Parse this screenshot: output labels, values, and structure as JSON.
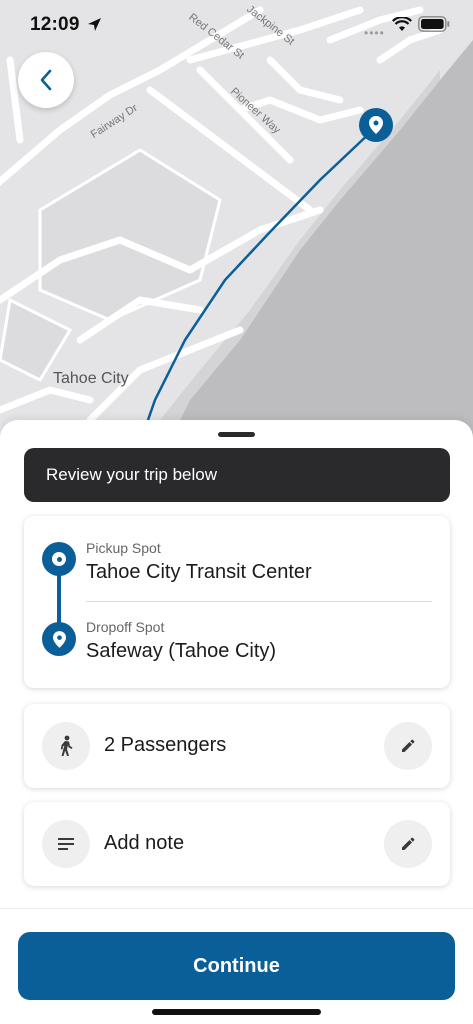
{
  "status_bar": {
    "time": "12:09",
    "icons": [
      "location-arrow-icon",
      "wifi-icon",
      "battery-icon"
    ]
  },
  "map": {
    "town_label": "Tahoe City",
    "streets": [
      "Fairway Dr",
      "Red Cedar St",
      "Jackpine St",
      "Pioneer Way"
    ],
    "route_color": "#0b5f99",
    "pin_icon": "map-pin-icon"
  },
  "nav": {
    "back_icon": "chevron-left-icon"
  },
  "banner": {
    "text": "Review your trip below"
  },
  "trip": {
    "pickup_label": "Pickup Spot",
    "pickup_name": "Tahoe City Transit Center",
    "dropoff_label": "Dropoff Spot",
    "dropoff_name": "Safeway (Tahoe City)"
  },
  "passengers": {
    "text": "2 Passengers",
    "icon": "person-walking-icon",
    "edit_icon": "pencil-icon"
  },
  "note": {
    "text": "Add note",
    "icon": "notes-lines-icon",
    "edit_icon": "pencil-icon"
  },
  "footer": {
    "continue_label": "Continue"
  },
  "colors": {
    "brand": "#0b5f99",
    "banner_bg": "#2a2a2c",
    "map_land": "#e4e4e6",
    "map_water": "#bfbfc1"
  }
}
